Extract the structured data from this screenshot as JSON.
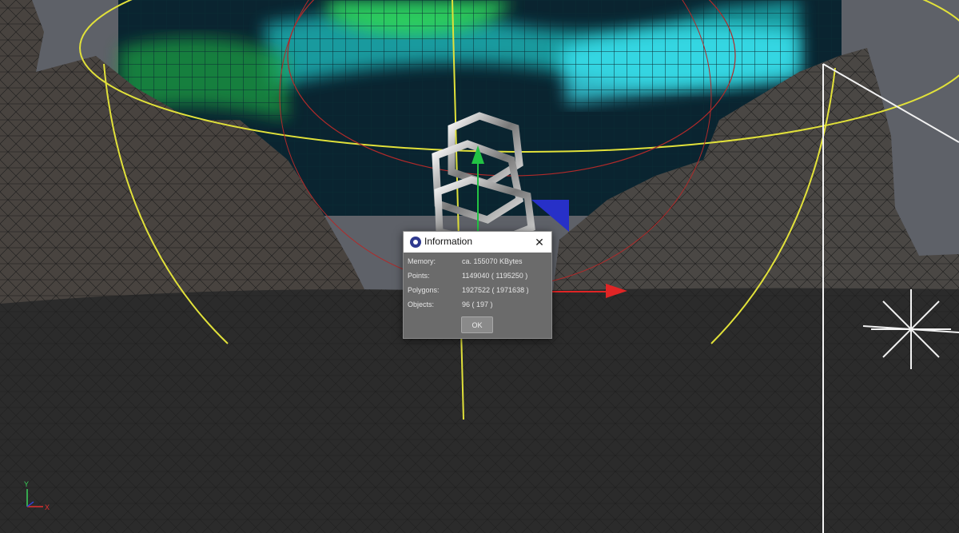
{
  "dialog": {
    "title": "Information",
    "close_glyph": "✕",
    "rows": [
      {
        "label": "Memory:",
        "value": "ca. 155070 KBytes"
      },
      {
        "label": "Points:",
        "value": "1149040 ( 1195250 )"
      },
      {
        "label": "Polygons:",
        "value": "1927522 ( 1971638 )"
      },
      {
        "label": "Objects:",
        "value": "96 ( 197 )"
      }
    ],
    "ok_label": "OK"
  },
  "axis_indicator": {
    "x_label": "X",
    "y_label": "Y"
  },
  "colors": {
    "viewport_bg": "#5e6168",
    "ground": "#2b2b2b",
    "aurora_green": "#2fd35a",
    "aurora_cyan": "#22d9d9",
    "selection_yellow": "#e1e13a",
    "move_x": "#e02525",
    "move_y": "#22c244",
    "move_z": "#2730c8"
  },
  "icons": [
    "app-logo-icon",
    "close-icon",
    "axis-indicator-icon",
    "light-object-icon"
  ]
}
